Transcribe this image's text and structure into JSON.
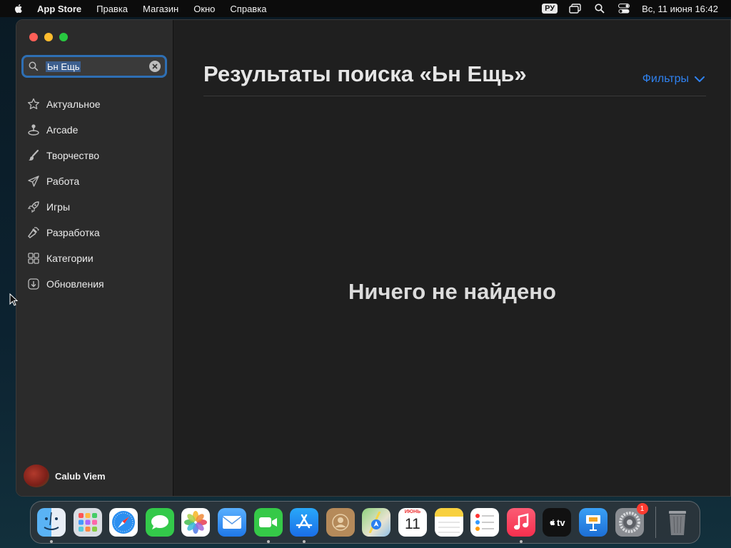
{
  "menubar": {
    "app_name": "App Store",
    "menus": [
      "Правка",
      "Магазин",
      "Окно",
      "Справка"
    ],
    "input_language": "РУ",
    "datetime": "Вс, 11 июня  16:42"
  },
  "sidebar": {
    "search": {
      "value": "Ьн Ещь"
    },
    "items": [
      {
        "label": "Актуальное",
        "icon": "star-icon"
      },
      {
        "label": "Arcade",
        "icon": "joystick-icon"
      },
      {
        "label": "Творчество",
        "icon": "paintbrush-icon"
      },
      {
        "label": "Работа",
        "icon": "paperplane-icon"
      },
      {
        "label": "Игры",
        "icon": "rocket-icon"
      },
      {
        "label": "Разработка",
        "icon": "hammer-icon"
      },
      {
        "label": "Категории",
        "icon": "grid-icon"
      },
      {
        "label": "Обновления",
        "icon": "download-icon"
      }
    ],
    "account": {
      "name": "Calub Viem"
    }
  },
  "main": {
    "title": "Результаты поиска «Ьн Ещь»",
    "filters_label": "Фильтры",
    "empty_message": "Ничего не найдено"
  },
  "dock": {
    "calendar": {
      "month": "ИЮНЬ",
      "day": "11"
    },
    "tv_label": "tv",
    "settings_badge": "1",
    "apps": [
      "finder",
      "launchpad",
      "safari",
      "messages",
      "photos",
      "mail",
      "facetime",
      "app-store",
      "contacts",
      "maps",
      "calendar",
      "notes",
      "reminders",
      "music",
      "tv",
      "keynote",
      "system-settings",
      "trash"
    ]
  },
  "colors": {
    "accent": "#2f82f0",
    "sidebar_bg": "#2b2b2b",
    "main_bg": "#1f1f1f"
  }
}
